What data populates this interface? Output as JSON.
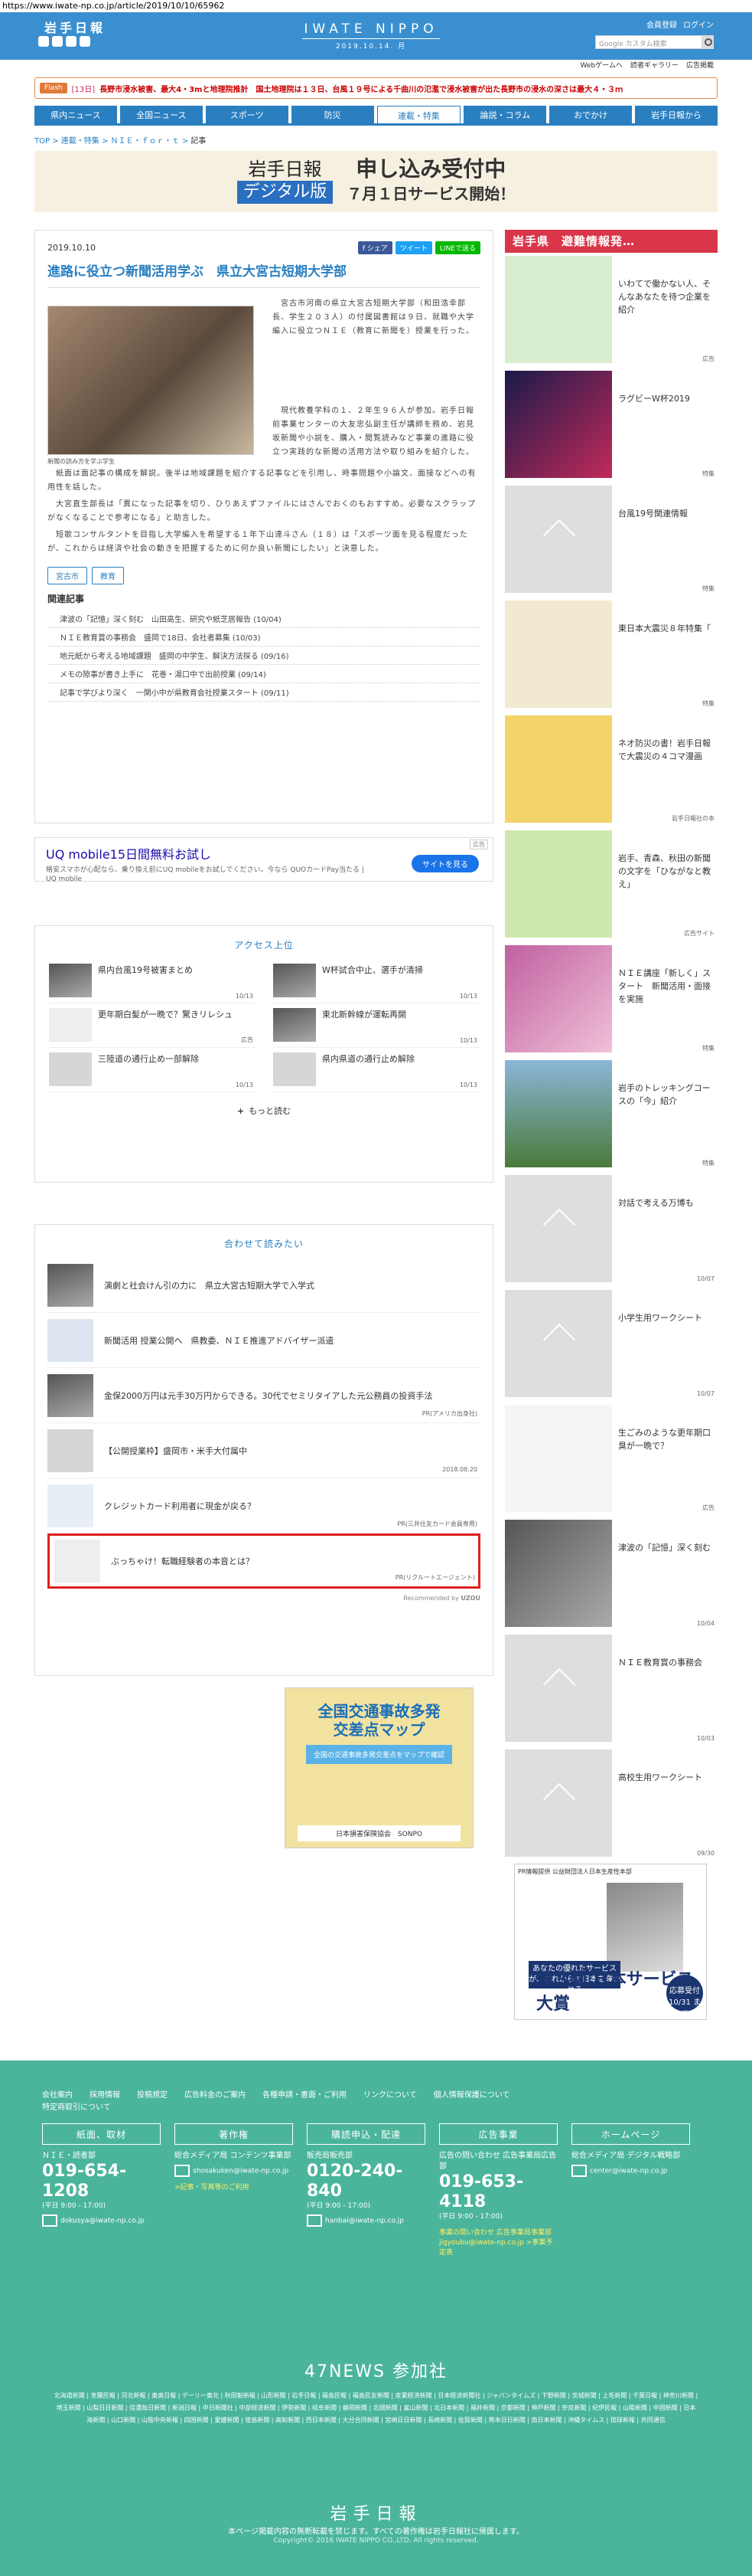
{
  "url": "https://www.iwate-np.co.jp/article/2019/10/10/65962",
  "header": {
    "logo": "岩手日報",
    "brand": "IWATE NIPPO",
    "date": "2019.10.14. 月",
    "register": "会員登録",
    "login": "ログイン",
    "search_placeholder": "Google カスタム検索"
  },
  "subnav": [
    "Webゲームへ",
    "読者ギャラリー",
    "広告掲載"
  ],
  "flash": {
    "tag": "Flash",
    "date": "[13日]",
    "text": "長野市浸水被害、最大4・3mと地理院推計　国土地理院は１３日、台風１９号による千曲川の氾濫で浸水被害が出た長野市の浸水の深さは最大４・３ｍ"
  },
  "nav": [
    "県内ニュース",
    "全国ニュース",
    "スポーツ",
    "防災",
    "連載・特集",
    "論説・コラム",
    "おでかけ",
    "岩手日報から"
  ],
  "nav_active": 4,
  "breadcrumb": {
    "items": [
      "TOP",
      "連載・特集",
      "ＮＩＥ・ｆｏｒ・ｔ",
      "記事"
    ]
  },
  "ad_top": {
    "l1": "岩手日報",
    "l2": "デジタル版",
    "r1": "申し込み受付中",
    "r2": "７月１日サービス開始！"
  },
  "article": {
    "date": "2019.10.10",
    "share": [
      "f シェア",
      "ツイート",
      "LINEで送る"
    ],
    "title": "進路に役立つ新聞活用学ぶ　県立大宮古短期大学部",
    "caption": "新聞の読み方を学ぶ学生",
    "p1": "　宮古市河南の県立大宮古短期大学部（和田浩幸部長、学生２０３人）の付属図書館は９日、就職や大学編入に役立つＮＩＥ（教育に新聞を）授業を行った。",
    "p2": "　現代教養学科の１、２年生９６人が参加。岩手日報前事業センターの大友忠弘副主任が講師を務め、岩見坂新聞や小説を、購入・閲覧読みなど事業の進路に役立つ実践的な新聞の活用方法や取り組みを紹介した。",
    "p3": "　紙面は面記事の構成を解説。後半は地域課題を紹介する記事などを引用し、時事問題や小論文、面接などへの有用性を話した。",
    "p4": "　大宮直生部長は「異になった記事を切り、ひりあえずファイルにはさんでおくのもおすすめ。必要なスクラップがなくなることで参考になる」と助言した。",
    "p5": "　短歌コンサルタントを目指し大学編入を希望する１年下山達斗さん（１８）は「スポーツ面を見る程度だったが、これからは経済や社会の動きを把握するために何か良い新聞にしたい」と決意した。",
    "tags": [
      "宮古市",
      "教育"
    ],
    "related_title": "関連記事",
    "related": [
      "津波の「記憶」深く刻む　山田高生、研究や紙芝居報告 (10/04)",
      "ＮＩＥ教育賞の事務会　盛岡で18日、会社者募集 (10/03)",
      "地元紙から考える地域課題　盛岡の中学生、解決方法探る (09/16)",
      "メモの隙事が書き上手に　花巻・湯口中で出前授業 (09/14)",
      "記事で学びより深く　一関小中が県教育会社授業スタート (09/11)"
    ]
  },
  "uq_ad": {
    "title": "UQ mobile15日間無料お試し",
    "sub": "格安スマホが心配なら、乗り換え前にUQ mobileをお試しでください。今なら QUOカードPay当たる | UQ mobile",
    "btn": "サイトを見る",
    "tag": "広告"
  },
  "ranking": {
    "title": "アクセス上位",
    "items": [
      {
        "t": "県内台風19号被害まとめ",
        "d": "10/13"
      },
      {
        "t": "W杯試合中止、選手が清掃",
        "d": "10/13"
      },
      {
        "t": "更年期白髪が一晩で？驚きリレシュ",
        "d": "広告"
      },
      {
        "t": "東北新幹線が運転再開",
        "d": "10/13"
      },
      {
        "t": "三陸道の通行止め一部解除",
        "d": "10/13"
      },
      {
        "t": "県内県道の通行止め解除",
        "d": "10/13"
      }
    ],
    "more": "もっと読む"
  },
  "also_read": {
    "title": "合わせて読みたい",
    "items": [
      {
        "t": "演劇と社会けん引の力に　県立大宮古短期大学で入学式",
        "p": ""
      },
      {
        "t": "新聞活用 授業公開へ　県教委、ＮＩＥ推進アドバイザー派遣",
        "p": ""
      },
      {
        "t": "金保2000万円は元手30万円からできる。30代でセミリタイアした元公務員の投資手法",
        "p": "PR(アメリカ出身社)"
      },
      {
        "t": "【公開授業枠】盛岡市・米手大付属中",
        "p": "2018.08.20"
      },
      {
        "t": "クレジットカード利用者に現金が戻る？",
        "p": "PR(三井住友カード会員専用)"
      },
      {
        "t": "ぶっちゃけ！転職経験者の本音とは？",
        "p": "PR(リクルートエージェント)"
      }
    ],
    "recommended": "Recommended by",
    "brand": "UZOU"
  },
  "traffic_ad": {
    "a1": "全国交通事故多発",
    "a2": "交差点マップ",
    "b": "全国の交通事故多発交差点をマップで確認",
    "c": "日本損害保険協会　SONPO"
  },
  "sidebar": {
    "title": "岩手県　避難情報発…",
    "items": [
      {
        "t": "いわてで働かない人、そんなあなたを待つ企業を紹介",
        "tg": "広告"
      },
      {
        "t": "ラグビーW杯2019",
        "tg": "特集"
      },
      {
        "t": "台風19号関連情報",
        "tg": "特集"
      },
      {
        "t": "東日本大震災８年特集「",
        "tg": "特集"
      },
      {
        "t": "ネオ防災の書！岩手日報で大震災の４コマ漫画",
        "tg": "岩手日報社の本"
      },
      {
        "t": "岩手、青森、秋田の新聞の文字を「ひながなと教え」",
        "tg": "広告サイト"
      },
      {
        "t": "ＮＩＥ講座「新しく」スタート　新聞活用・面接を実施",
        "tg": "特集"
      },
      {
        "t": "岩手のトレッキングコースの「今」紹介",
        "tg": "特集"
      },
      {
        "t": "対話で考える万博も",
        "tg": "10/07"
      },
      {
        "t": "小学生用ワークシート",
        "tg": "10/07"
      },
      {
        "t": "生ごみのような更年期口臭が一晩で？",
        "tg": "広告"
      },
      {
        "t": "津波の「記憶」深く刻む",
        "tg": "10/04"
      },
      {
        "t": "ＮＩＥ教育賞の事務会",
        "tg": "10/03"
      },
      {
        "t": "高校生用ワークシート",
        "tg": "09/30"
      }
    ]
  },
  "award_ad": {
    "t1": "PR情報提供 公益財団法人日本生産性本部",
    "bl": "あなたの優れたサービスが、これからの日本を輝かせる",
    "big": "第３回 日本サービス大賞",
    "circ": "応募受付 10/31 まで"
  },
  "footer": {
    "links": [
      "会社案内",
      "採用情報",
      "投稿規定",
      "広告料金のご案内",
      "各種申請・書面・ご利用",
      "リンクについて",
      "個人情報保護について"
    ],
    "links2": "特定商取引について",
    "cols": [
      {
        "h": "紙面、取材",
        "s": "ＮＩＥ・読者部",
        "ph": "019-654-1208",
        "sm": "(平日 9:00 - 17:00)",
        "em": "dokusya@iwate-np.co.jp",
        "lk": ""
      },
      {
        "h": "著作権",
        "s": "総合メディア局 コンテンツ事業部",
        "ph": "",
        "sm": "",
        "em": "shosakuken@iwate-np.co.jp",
        "lk": ">記事・写真等のご利用"
      },
      {
        "h": "購読申込・配達",
        "s": "販売局販売部",
        "ph": "0120-240-840",
        "sm": "(平日 9:00 - 17:00)",
        "em": "hanbai@iwate-np.co.jp",
        "lk": ""
      },
      {
        "h": "広告事業",
        "s": "広告の問い合わせ 広告事業局広告部",
        "ph": "019-653-4118",
        "sm": "(平日 9:00 - 17:00)",
        "em": "",
        "lk": "事業の問い合わせ 広告事業局事業部 jigyoubu@iwate-np.co.jp >事業予定表"
      },
      {
        "h": "ホームページ",
        "s": "総合メディア局 デジタル戦略部",
        "ph": "",
        "sm": "",
        "em": "center@iwate-np.co.jp",
        "lk": ""
      }
    ],
    "n47": "47NEWS 参加社",
    "papers": "北海道新聞 | 室蘭民報 | 河北新報 | 東奥日報 | デーリー東北 | 秋田魁新報 | 山形新聞 | 岩手日報 | 福島民報 | 福島民友新聞 | 産業経済新聞 | 日本経済新聞社 | ジャパンタイムズ | 下野新聞 | 茨城新聞 | 上毛新聞 | 千葉日報 | 神奈川新聞 | 埼玉新聞 | 山梨日日新聞 | 信濃毎日新聞 | 新潟日報 | 中日新聞社 | 中部経済新聞 | 伊勢新聞 | 岐阜新聞 | 静岡新聞 | 北國新聞 | 富山新聞 | 北日本新聞 | 福井新聞 | 京都新聞 | 神戸新聞 | 奈良新聞 | 紀伊民報 | 山陽新聞 | 中国新聞 | 日本海新聞 | 山口新聞 | 山陰中央新報 | 四国新聞 | 愛媛新聞 | 徳島新聞 | 高知新聞 | 西日本新聞 | 大分合同新聞 | 宮崎日日新聞 | 長崎新聞 | 佐賀新聞 | 熊本日日新聞 | 南日本新聞 | 沖縄タイムス | 琉球新報 | 共同通信",
    "logo": "岩手日報",
    "cp1": "本ページ掲載内容の無断転載を禁じます。すべての著作権は岩手日報社に帰属します。",
    "cp2": "Copyright© 2016 IWATE NIPPO CO.,LTD. All rights reserved."
  }
}
